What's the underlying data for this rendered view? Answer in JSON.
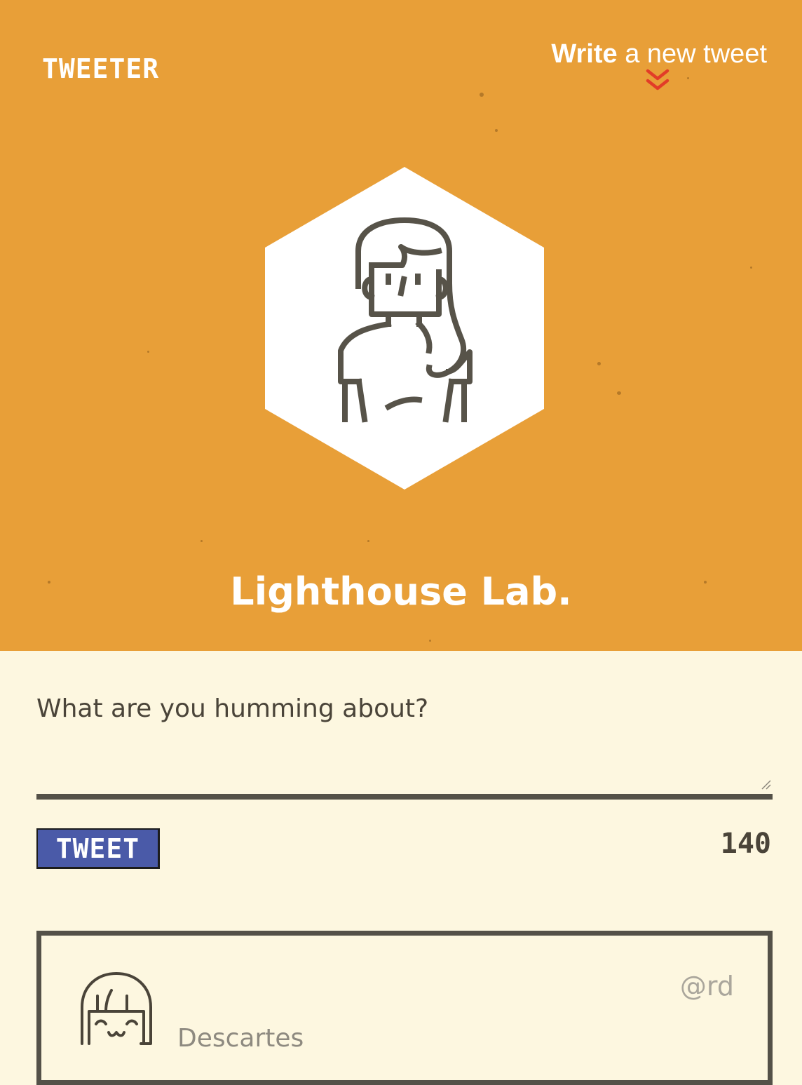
{
  "nav": {
    "brand": "TWEETER",
    "compose_strong": "Write",
    "compose_rest": " a new tweet",
    "compose_icon": "double-chevron-down-icon"
  },
  "profile": {
    "avatar_icon": "girl-avatar-icon",
    "name": "Lighthouse Lab."
  },
  "compose": {
    "prompt": "What are you humming about?",
    "textarea_value": "",
    "button_label": "TWEET",
    "counter": "140"
  },
  "tweets": [
    {
      "avatar_icon": "smiling-face-avatar-icon",
      "author": "Descartes",
      "handle": "@rd"
    }
  ],
  "colors": {
    "header_bg": "#e89f38",
    "page_bg": "#fdf7e0",
    "accent_red": "#e23c28",
    "button_bg": "#4a5aa8",
    "text_dark": "#4a4439"
  }
}
